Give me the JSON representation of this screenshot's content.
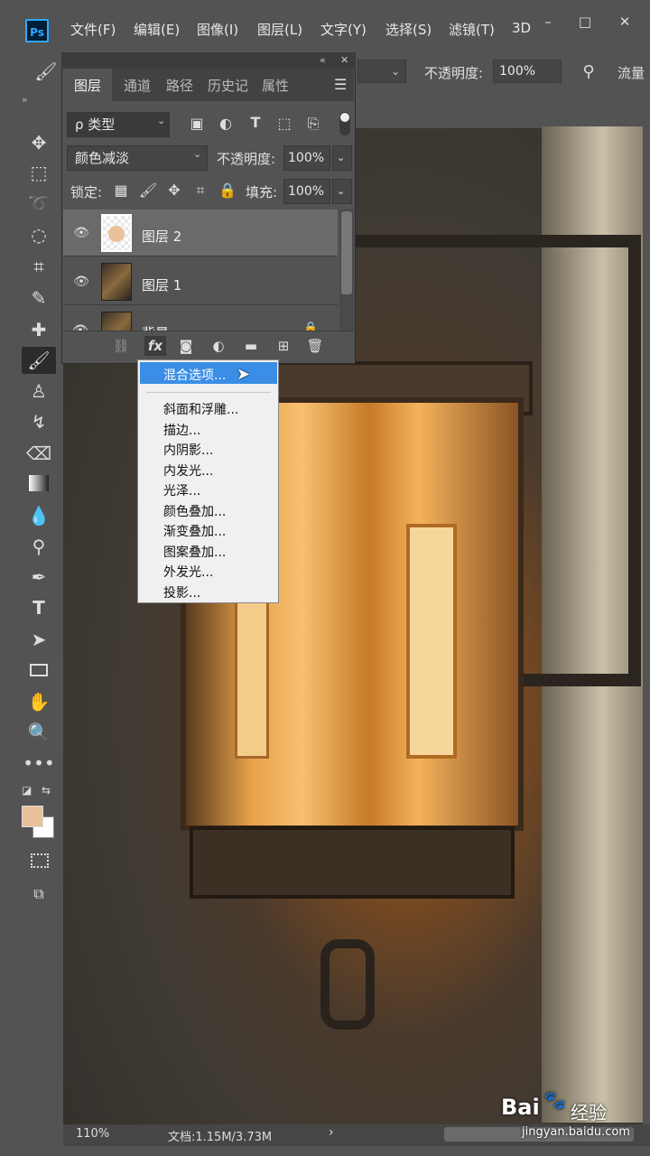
{
  "app": {
    "logo": "Ps"
  },
  "menubar": {
    "items": [
      "文件(F)",
      "编辑(E)",
      "图像(I)",
      "图层(L)",
      "文字(Y)",
      "选择(S)",
      "滤镜(T)",
      "3D"
    ],
    "window_controls": {
      "minimize": "–",
      "maximize": "□",
      "close": "✕"
    }
  },
  "options_bar": {
    "opacity_label": "不透明度:",
    "opacity_value": "100%",
    "flow_label": "流量"
  },
  "layers_panel": {
    "tabs": [
      "图层",
      "通道",
      "路径",
      "历史记",
      "属性"
    ],
    "active_tab": "图层",
    "filter_label": "ρ 类型",
    "blend_mode": "颜色减淡",
    "opacity_label": "不透明度:",
    "opacity_value": "100%",
    "lock_label": "锁定:",
    "fill_label": "填充:",
    "fill_value": "100%",
    "layers": [
      {
        "name": "图层 2",
        "selected": true
      },
      {
        "name": "图层 1",
        "selected": false
      },
      {
        "name": "背景",
        "selected": false
      }
    ],
    "footer_fx": "fx"
  },
  "context_menu": {
    "highlighted": "混合选项...",
    "items": [
      "斜面和浮雕...",
      "描边...",
      "内阴影...",
      "内发光...",
      "光泽...",
      "颜色叠加...",
      "渐变叠加...",
      "图案叠加...",
      "外发光...",
      "投影..."
    ]
  },
  "status_bar": {
    "zoom": "110%",
    "doc_info": "文档:1.15M/3.73M",
    "arrow": "›"
  },
  "watermark": {
    "brand": "Bai",
    "brand_suffix": "经验",
    "url": "jingyan.baidu.com"
  },
  "colors": {
    "foreground": "#e9c19a",
    "background": "#ffffff",
    "highlight": "#3a8ee6"
  }
}
